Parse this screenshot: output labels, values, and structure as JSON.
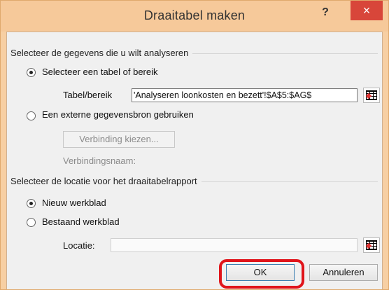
{
  "dialog": {
    "title": "Draaitabel maken",
    "help_glyph": "?",
    "close_glyph": "×"
  },
  "section_data": {
    "title": "Selecteer de gegevens die u wilt analyseren",
    "option_table": "Selecteer een tabel of bereik",
    "table_range_label": "Tabel/bereik",
    "table_range_value": "'Analyseren loonkosten en bezett'!$A$5:$AG$",
    "option_external": "Een externe gegevensbron gebruiken",
    "connection_button": "Verbinding kiezen...",
    "connection_name_label": "Verbindingsnaam:"
  },
  "section_location": {
    "title": "Selecteer de locatie voor het draaitabelrapport",
    "option_new": "Nieuw werkblad",
    "option_existing": "Bestaand werkblad",
    "location_label": "Locatie:",
    "location_value": ""
  },
  "buttons": {
    "ok": "OK",
    "cancel": "Annuleren"
  },
  "colors": {
    "title_bar": "#f6c99a",
    "close_button": "#d8463a",
    "highlight": "#e0151b"
  }
}
